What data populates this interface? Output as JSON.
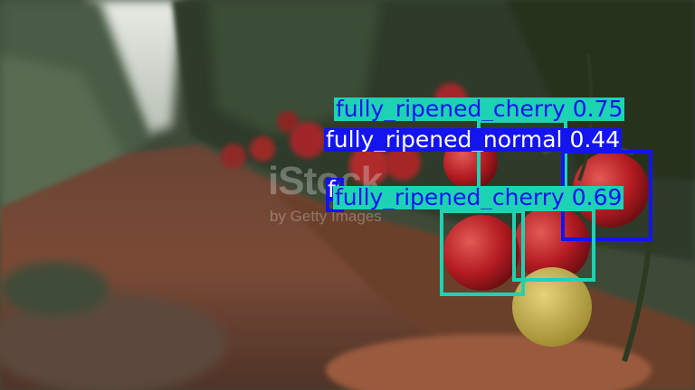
{
  "watermark": {
    "brand": "iStock",
    "credit": "by Getty Images"
  },
  "colors": {
    "cherry": "#1ed2b4",
    "normal": "#1414f0",
    "cherry_text": "#1414f0",
    "normal_text": "#ffffff"
  },
  "detections": [
    {
      "label": "fully_ripened_cherry",
      "confidence": "0.75",
      "class": "cherry"
    },
    {
      "label": "fully_ripened_normal",
      "confidence": "0.44",
      "class": "normal"
    },
    {
      "label": "fully_ripened_normal",
      "confidence": "",
      "class": "normal"
    },
    {
      "label": "fully_ripened_cherry",
      "confidence": "0.69",
      "class": "cherry"
    },
    {
      "label": "fully_ripened_cherry",
      "confidence": "",
      "class": "cherry"
    }
  ]
}
